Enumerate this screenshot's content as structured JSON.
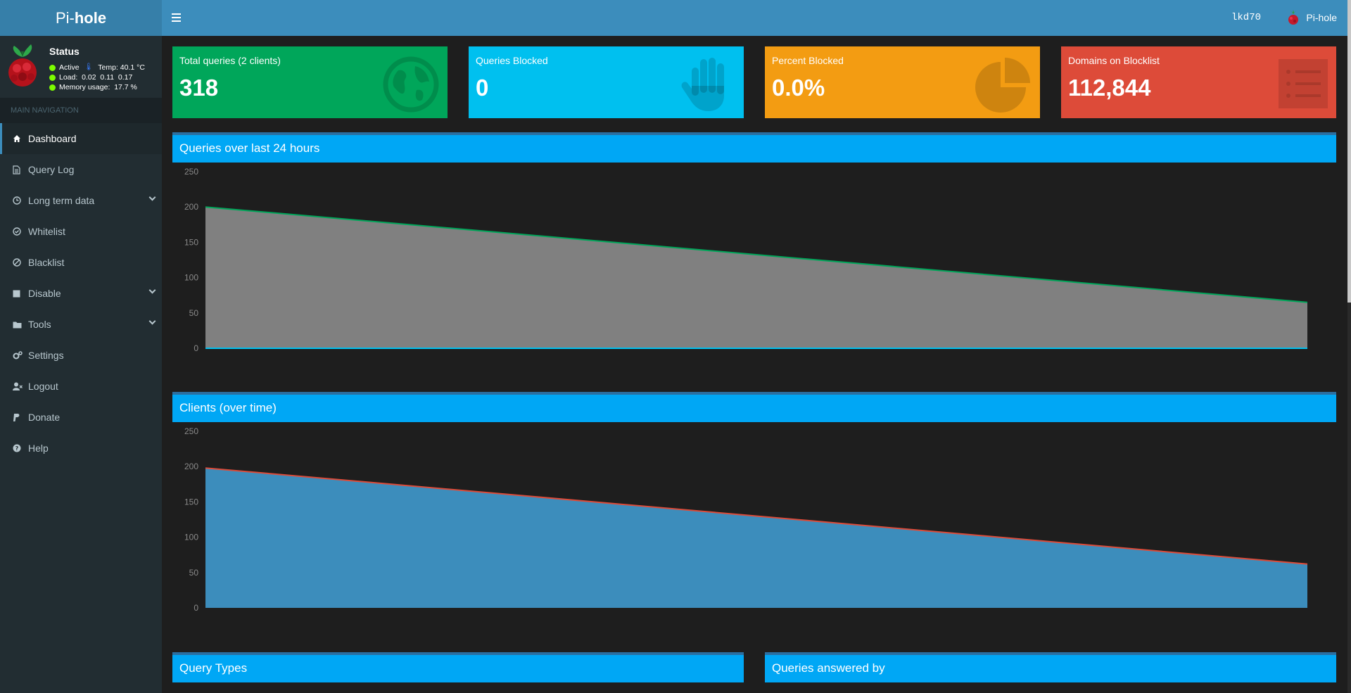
{
  "header": {
    "logo_prefix": "Pi-",
    "logo_bold": "hole",
    "hostname": "lkd70",
    "user_label": "Pi-hole"
  },
  "status": {
    "title": "Status",
    "active": "Active",
    "temp": "Temp: 40.1 °C",
    "load": "Load:  0.02  0.11  0.17",
    "memory": "Memory usage:  17.7 %"
  },
  "nav": {
    "header": "MAIN NAVIGATION",
    "items": [
      {
        "label": "Dashboard",
        "icon": "home-icon"
      },
      {
        "label": "Query Log",
        "icon": "file-icon"
      },
      {
        "label": "Long term data",
        "icon": "clock-icon"
      },
      {
        "label": "Whitelist",
        "icon": "check-circle-icon"
      },
      {
        "label": "Blacklist",
        "icon": "ban-icon"
      },
      {
        "label": "Disable",
        "icon": "stop-icon"
      },
      {
        "label": "Tools",
        "icon": "folder-icon"
      },
      {
        "label": "Settings",
        "icon": "gears-icon"
      },
      {
        "label": "Logout",
        "icon": "user-times-icon"
      },
      {
        "label": "Donate",
        "icon": "paypal-icon"
      },
      {
        "label": "Help",
        "icon": "question-circle-icon"
      }
    ]
  },
  "stats": {
    "total_label": "Total queries (2 clients)",
    "total_value": "318",
    "blocked_label": "Queries Blocked",
    "blocked_value": "0",
    "percent_label": "Percent Blocked",
    "percent_value": "0.0%",
    "domains_label": "Domains on Blocklist",
    "domains_value": "112,844"
  },
  "colors": {
    "green": "#00a65a",
    "aqua": "#00c0ef",
    "yellow": "#f39c12",
    "red": "#dd4b39",
    "header_blue": "#3c8dbc",
    "box_header": "#00a7f5"
  },
  "charts": {
    "queries_title": "Queries over last 24 hours",
    "clients_title": "Clients (over time)",
    "query_types_title": "Query Types",
    "answered_by_title": "Queries answered by"
  },
  "chart_data": [
    {
      "type": "area",
      "title": "Queries over last 24 hours",
      "yticks": [
        "250",
        "200",
        "150",
        "100",
        "50",
        "0"
      ],
      "ylim": [
        0,
        250
      ],
      "x": [
        0,
        1
      ],
      "series": [
        {
          "values": [
            200,
            65
          ],
          "color": "#00a65a",
          "fill": "#808080"
        },
        {
          "values": [
            0,
            0
          ],
          "color": "#00c0ef",
          "fill": "none"
        }
      ]
    },
    {
      "type": "area",
      "title": "Clients (over time)",
      "yticks": [
        "250",
        "200",
        "150",
        "100",
        "50",
        "0"
      ],
      "ylim": [
        0,
        250
      ],
      "x": [
        0,
        1
      ],
      "series": [
        {
          "values": [
            198,
            62
          ],
          "color": "#dd4b39",
          "fill": "#3c8dbc"
        }
      ]
    }
  ]
}
